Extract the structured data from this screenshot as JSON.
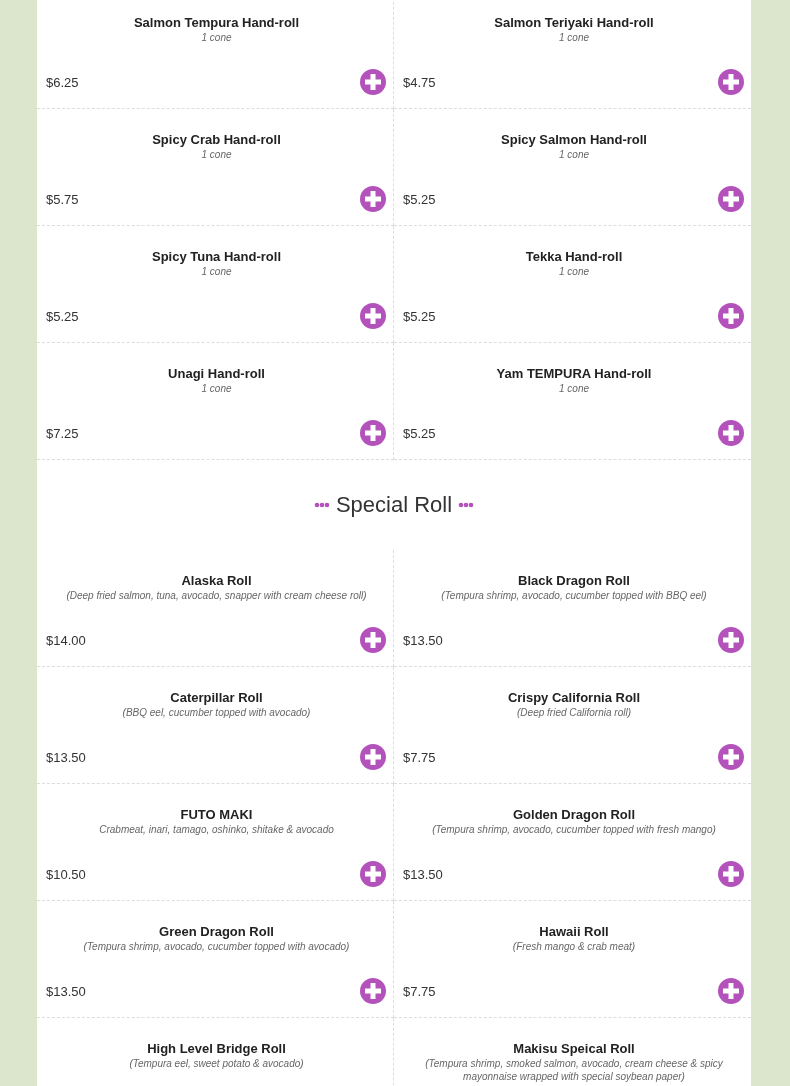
{
  "sections": [
    {
      "items": [
        {
          "name": "Salmon Tempura Hand-roll",
          "description": "1 cone",
          "price": "$6.25"
        },
        {
          "name": "Salmon Teriyaki Hand-roll",
          "description": "1 cone",
          "price": "$4.75"
        },
        {
          "name": "Spicy Crab Hand-roll",
          "description": "1 cone",
          "price": "$5.75"
        },
        {
          "name": "Spicy Salmon Hand-roll",
          "description": "1 cone",
          "price": "$5.25"
        },
        {
          "name": "Spicy Tuna Hand-roll",
          "description": "1 cone",
          "price": "$5.25"
        },
        {
          "name": "Tekka Hand-roll",
          "description": "1 cone",
          "price": "$5.25"
        },
        {
          "name": "Unagi Hand-roll",
          "description": "1 cone",
          "price": "$7.25"
        },
        {
          "name": "Yam TEMPURA Hand-roll",
          "description": "1 cone",
          "price": "$5.25"
        }
      ]
    },
    {
      "title": "Special Roll",
      "items": [
        {
          "name": "Alaska Roll",
          "description": "(Deep fried salmon, tuna, avocado, snapper with cream cheese roll)",
          "price": "$14.00"
        },
        {
          "name": "Black Dragon Roll",
          "description": "(Tempura shrimp, avocado, cucumber topped with BBQ eel)",
          "price": "$13.50"
        },
        {
          "name": "Caterpillar Roll",
          "description": "(BBQ eel, cucumber topped with avocado)",
          "price": "$13.50"
        },
        {
          "name": "Crispy California Roll",
          "description": "(Deep fried California roll)",
          "price": "$7.75"
        },
        {
          "name": "FUTO MAKI",
          "description": "Crabmeat, inari, tamago, oshinko, shitake & avocado",
          "price": "$10.50"
        },
        {
          "name": "Golden Dragon Roll",
          "description": "(Tempura shrimp, avocado, cucumber topped with fresh mango)",
          "price": "$13.50"
        },
        {
          "name": "Green Dragon Roll",
          "description": "(Tempura shrimp, avocado, cucumber topped with avocado)",
          "price": "$13.50"
        },
        {
          "name": "Hawaii Roll",
          "description": "(Fresh mango & crab meat)",
          "price": "$7.75"
        },
        {
          "name": "High Level Bridge Roll",
          "description": "(Tempura eel, sweet potato & avocado)"
        },
        {
          "name": "Makisu Speical Roll",
          "description": "(Tempura shrimp, smoked salmon, avocado, cream cheese & spicy mayonnaise wrapped with special soybean paper)"
        }
      ]
    }
  ]
}
